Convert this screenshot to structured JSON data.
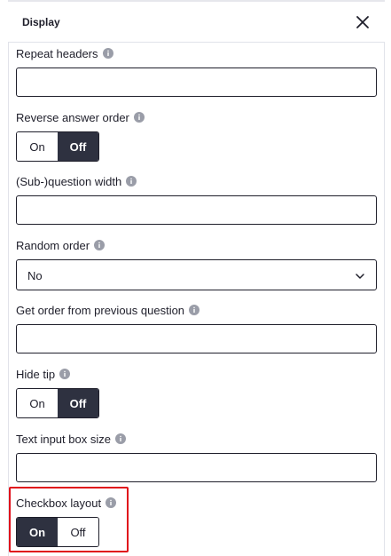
{
  "header": {
    "title": "Display"
  },
  "fields": {
    "repeat_headers": {
      "label": "Repeat headers",
      "value": ""
    },
    "reverse_answer_order": {
      "label": "Reverse answer order",
      "on": "On",
      "off": "Off",
      "selected": "Off"
    },
    "subquestion_width": {
      "label": "(Sub-)question width",
      "value": ""
    },
    "random_order": {
      "label": "Random order",
      "value": "No"
    },
    "get_order": {
      "label": "Get order from previous question",
      "value": ""
    },
    "hide_tip": {
      "label": "Hide tip",
      "on": "On",
      "off": "Off",
      "selected": "Off"
    },
    "text_input_box_size": {
      "label": "Text input box size",
      "value": ""
    },
    "checkbox_layout": {
      "label": "Checkbox layout",
      "on": "On",
      "off": "Off",
      "selected": "On"
    }
  },
  "colors": {
    "accent": "#2e3140",
    "highlight": "#e0101b",
    "border": "#1e1e2a"
  },
  "icons": {
    "close": "close-icon",
    "info": "info-icon",
    "chevron": "chevron-down-icon"
  }
}
